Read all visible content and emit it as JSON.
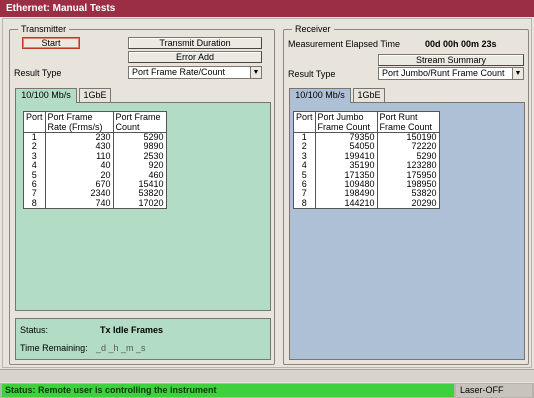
{
  "window": {
    "title": "Ethernet: Manual Tests"
  },
  "transmitter": {
    "group_label": "Transmitter",
    "start_label": "Start",
    "transmit_duration_label": "Transmit Duration",
    "error_add_label": "Error Add",
    "result_type_label": "Result Type",
    "result_type_value": "Port Frame Rate/Count",
    "tabs": [
      {
        "label": "10/100 Mb/s"
      },
      {
        "label": "1GbE"
      }
    ],
    "table": {
      "headers": {
        "port": "Port",
        "col1_line1": "Port Frame",
        "col1_line2": "Rate (Frms/s)",
        "col2_line1": "Port Frame",
        "col2_line2": "Count"
      },
      "rows": [
        {
          "port": "1",
          "rate": "230",
          "count": "5290"
        },
        {
          "port": "2",
          "rate": "430",
          "count": "9890"
        },
        {
          "port": "3",
          "rate": "110",
          "count": "2530"
        },
        {
          "port": "4",
          "rate": "40",
          "count": "920"
        },
        {
          "port": "5",
          "rate": "20",
          "count": "460"
        },
        {
          "port": "6",
          "rate": "670",
          "count": "15410"
        },
        {
          "port": "7",
          "rate": "2340",
          "count": "53820"
        },
        {
          "port": "8",
          "rate": "740",
          "count": "17020"
        }
      ]
    },
    "status_label": "Status:",
    "status_value": "Tx Idle Frames",
    "time_remaining_label": "Time Remaining:",
    "time_remaining_value": "_d _h _m _s"
  },
  "receiver": {
    "group_label": "Receiver",
    "elapsed_label": "Measurement Elapsed Time",
    "elapsed_value": "00d 00h 00m 23s",
    "stream_summary_label": "Stream Summary",
    "result_type_label": "Result Type",
    "result_type_value": "Port Jumbo/Runt Frame Count",
    "tabs": [
      {
        "label": "10/100 Mb/s"
      },
      {
        "label": "1GbE"
      }
    ],
    "table": {
      "headers": {
        "port": "Port",
        "col1_line1": "Port Jumbo",
        "col1_line2": "Frame Count",
        "col2_line1": "Port Runt",
        "col2_line2": "Frame Count"
      },
      "rows": [
        {
          "port": "1",
          "jumbo": "79350",
          "runt": "150190"
        },
        {
          "port": "2",
          "jumbo": "54050",
          "runt": "72220"
        },
        {
          "port": "3",
          "jumbo": "199410",
          "runt": "5290"
        },
        {
          "port": "4",
          "jumbo": "35190",
          "runt": "123280"
        },
        {
          "port": "5",
          "jumbo": "171350",
          "runt": "175950"
        },
        {
          "port": "6",
          "jumbo": "109480",
          "runt": "198950"
        },
        {
          "port": "7",
          "jumbo": "198490",
          "runt": "53820"
        },
        {
          "port": "8",
          "jumbo": "144210",
          "runt": "20290"
        }
      ]
    }
  },
  "statusbar": {
    "message": "Status: Remote user is controlling the instrument",
    "laser": "Laser-OFF"
  },
  "colors": {
    "title_bg": "#9b2d45",
    "tx_panel": "#b3dcc4",
    "rx_panel": "#aec0d6",
    "status_ok": "#3dd13d"
  }
}
